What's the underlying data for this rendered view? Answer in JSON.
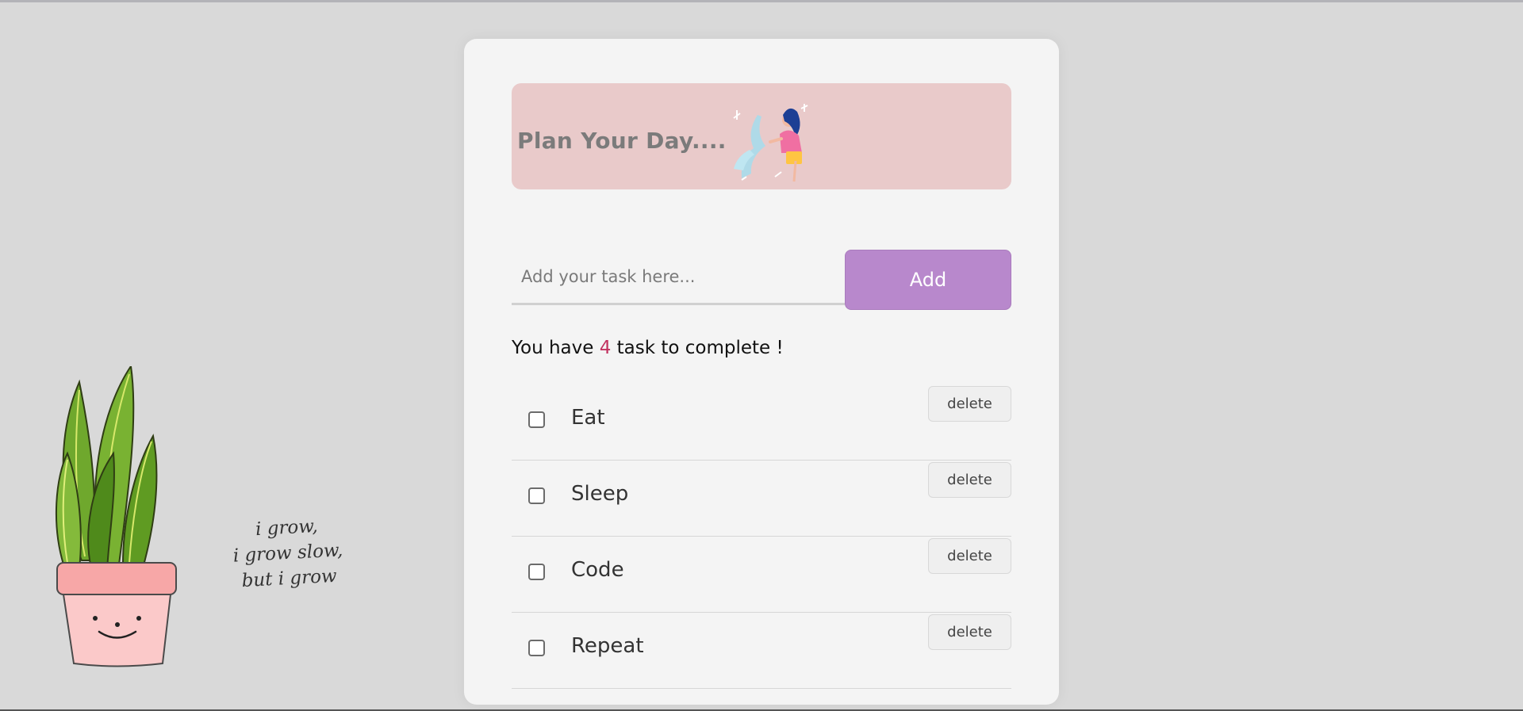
{
  "banner": {
    "title": "Plan Your Day...."
  },
  "input": {
    "placeholder": "Add your task here...",
    "value": ""
  },
  "add_button": {
    "label": "Add"
  },
  "summary": {
    "prefix": "You have ",
    "count": "4",
    "suffix": " task to complete !"
  },
  "tasks": [
    {
      "label": "Eat",
      "checked": false,
      "delete_label": "delete"
    },
    {
      "label": "Sleep",
      "checked": false,
      "delete_label": "delete"
    },
    {
      "label": "Code",
      "checked": false,
      "delete_label": "delete"
    },
    {
      "label": "Repeat",
      "checked": false,
      "delete_label": "delete"
    }
  ],
  "quote": {
    "lines": [
      "i grow,",
      "i grow slow,",
      "but i grow"
    ]
  },
  "colors": {
    "background": "#d9d9d9",
    "card": "#f4f4f4",
    "banner": "#e9caca",
    "accent": "#b888cc",
    "count": "#c2325f"
  }
}
